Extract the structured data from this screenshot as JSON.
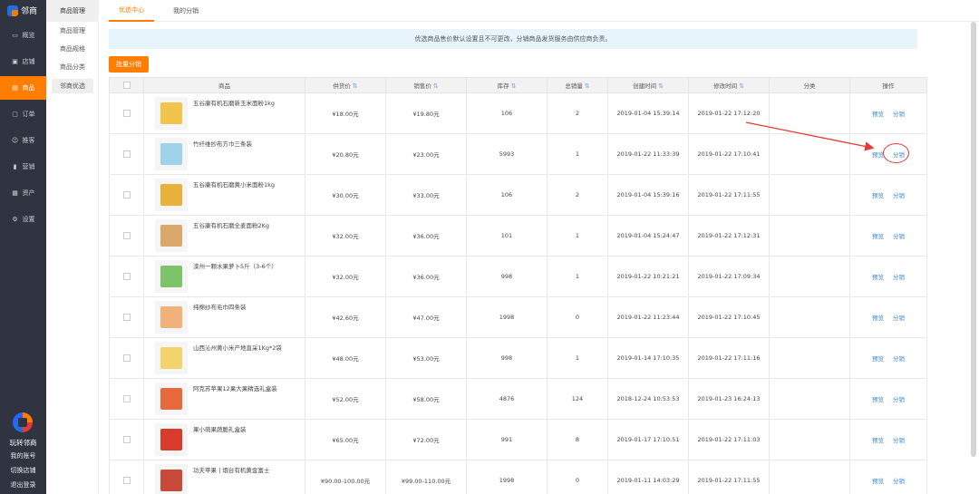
{
  "app": {
    "brand": "邻商"
  },
  "nav": {
    "items": [
      {
        "label": "概览",
        "icon": "monitor-icon"
      },
      {
        "label": "店铺",
        "icon": "store-icon"
      },
      {
        "label": "商品",
        "icon": "bag-icon"
      },
      {
        "label": "订单",
        "icon": "order-icon"
      },
      {
        "label": "推客",
        "icon": "users-icon"
      },
      {
        "label": "营销",
        "icon": "chart-icon"
      },
      {
        "label": "资产",
        "icon": "wallet-icon"
      },
      {
        "label": "设置",
        "icon": "gear-icon"
      }
    ],
    "active": "商品",
    "bottom": {
      "brand": "玩转邻商",
      "account": "我的账号",
      "switch": "切换店铺",
      "logout": "退出登录"
    }
  },
  "subnav": {
    "title": "商品管理",
    "items": [
      {
        "label": "商品管理"
      },
      {
        "label": "商品规格"
      },
      {
        "label": "商品分类"
      },
      {
        "label": "邻商优选"
      }
    ],
    "active": "邻商优选"
  },
  "tabs": [
    {
      "label": "优选中心",
      "active": true
    },
    {
      "label": "我的分销",
      "active": false
    }
  ],
  "notice": "优选商品售价默认设置且不可更改，分销商品发货服务由供应商负责。",
  "batch_button": "批量分销",
  "table": {
    "headers": [
      "商品",
      "供货价",
      "销售价",
      "库存",
      "总销量",
      "创建时间",
      "修改时间",
      "分类",
      "操作"
    ],
    "action_preview": "预览",
    "action_distribute": "分销",
    "rows": [
      {
        "name": "五谷康有机石磨新玉米面粉1kg",
        "supply": "¥18.00元",
        "price": "¥19.80元",
        "stock": "106",
        "sales": "2",
        "created": "2019-01-04 15:39:14",
        "modified": "2019-01-22 17:12:20",
        "category": "",
        "thumb": "#f1c44a"
      },
      {
        "name": "竹纤维抄布方巾三条装",
        "supply": "¥20.80元",
        "price": "¥23.00元",
        "stock": "5993",
        "sales": "1",
        "created": "2019-01-22 11:33:39",
        "modified": "2019-01-22 17:10:41",
        "category": "",
        "thumb": "#9fd3ea"
      },
      {
        "name": "五谷康有机石磨黄小米面粉1kg",
        "supply": "¥30.00元",
        "price": "¥33.00元",
        "stock": "106",
        "sales": "2",
        "created": "2019-01-04 15:39:16",
        "modified": "2019-01-22 17:11:55",
        "category": "",
        "thumb": "#e8b23a"
      },
      {
        "name": "五谷康有机石磨全麦面粉2Kg",
        "supply": "¥32.00元",
        "price": "¥36.00元",
        "stock": "101",
        "sales": "1",
        "created": "2019-01-04 15:24:47",
        "modified": "2019-01-22 17:12:31",
        "category": "",
        "thumb": "#d9a86a"
      },
      {
        "name": "滦州一颗水果萝卜5斤（3-6个）",
        "supply": "¥32.00元",
        "price": "¥36.00元",
        "stock": "998",
        "sales": "1",
        "created": "2019-01-22 10:21:21",
        "modified": "2019-01-22 17:09:34",
        "category": "",
        "thumb": "#7cc36a"
      },
      {
        "name": "纯棉纱布毛巾四条装",
        "supply": "¥42.60元",
        "price": "¥47.00元",
        "stock": "1998",
        "sales": "0",
        "created": "2019-01-22 11:23:44",
        "modified": "2019-01-22 17:10:45",
        "category": "",
        "thumb": "#f2b07a"
      },
      {
        "name": "山西沁州黄小米产地直采1Kg*2袋",
        "supply": "¥48.00元",
        "price": "¥53.00元",
        "stock": "998",
        "sales": "1",
        "created": "2019-01-14 17:10:35",
        "modified": "2019-01-22 17:11:16",
        "category": "",
        "thumb": "#f3d36b"
      },
      {
        "name": "阿克苏苹果12果大果精选礼盒装",
        "supply": "¥52.00元",
        "price": "¥58.00元",
        "stock": "4876",
        "sales": "124",
        "created": "2018-12-24 10:53:53",
        "modified": "2019-01-23 16:24:13",
        "category": "",
        "thumb": "#e86a3c"
      },
      {
        "name": "果小萌果蔬脆礼盒装",
        "supply": "¥65.00元",
        "price": "¥72.00元",
        "stock": "991",
        "sales": "8",
        "created": "2019-01-17 17:10:51",
        "modified": "2019-01-22 17:11:03",
        "category": "",
        "thumb": "#d83a2c"
      },
      {
        "name": "功夫苹果 | 烟台有机黄金富士",
        "supply": "¥90.00-100.00元",
        "price": "¥99.00-110.00元",
        "stock": "1998",
        "sales": "0",
        "created": "2019-01-11 14:03:29",
        "modified": "2019-01-22 17:11:55",
        "category": "",
        "thumb": "#c94a3a"
      }
    ]
  },
  "colors": {
    "accent": "#ff7d00",
    "sidebar": "#2f3440",
    "link": "#3a87d9",
    "annotation": "#e53935"
  }
}
